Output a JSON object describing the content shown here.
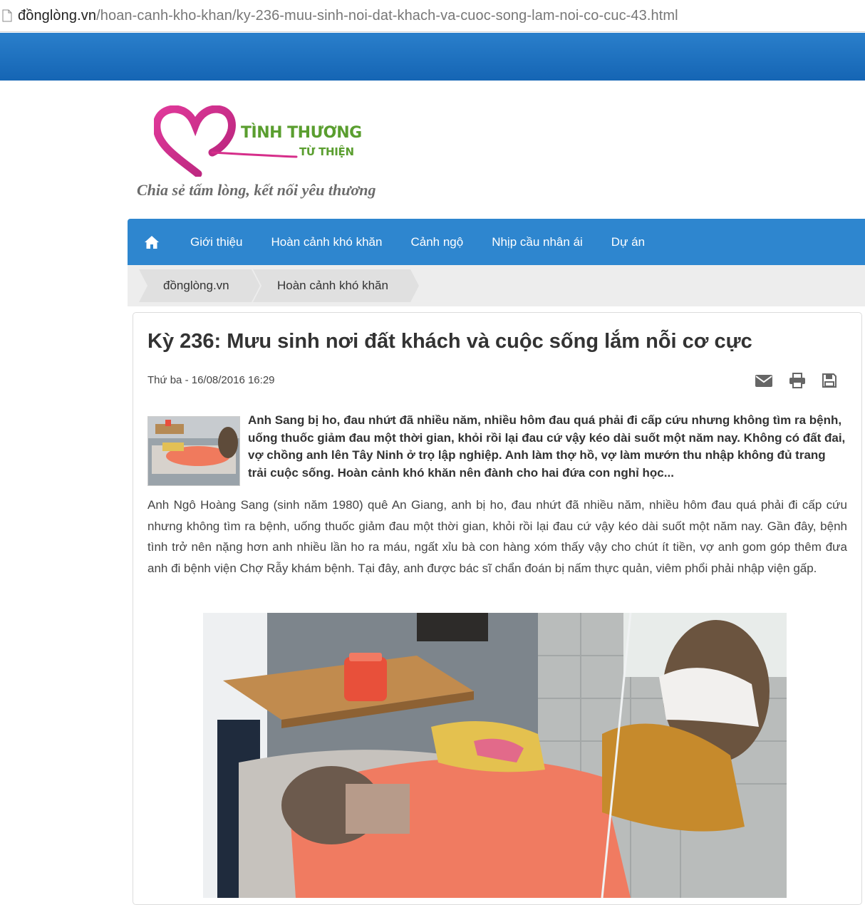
{
  "browser": {
    "url_domain": "đồnglòng.vn",
    "url_path": "/hoan-canh-kho-khan/ky-236-muu-sinh-noi-dat-khach-va-cuoc-song-lam-noi-co-cuc-43.html"
  },
  "header": {
    "logo_line1": "TÌNH THƯƠNG",
    "logo_line2": "TỪ THIỆN",
    "tagline": "Chia sẻ tấm lòng, kết nối yêu thương"
  },
  "nav": {
    "home_icon": "home-icon",
    "items": [
      {
        "label": "Giới thiệu"
      },
      {
        "label": "Hoàn cảnh khó khăn"
      },
      {
        "label": "Cảnh ngộ"
      },
      {
        "label": "Nhịp cầu nhân ái"
      },
      {
        "label": "Dự án"
      }
    ]
  },
  "breadcrumb": {
    "items": [
      {
        "label": "đồnglòng.vn"
      },
      {
        "label": "Hoàn cảnh khó khăn"
      }
    ]
  },
  "article": {
    "title": "Kỳ 236: Mưu sinh nơi đất khách và cuộc sống lắm nỗi cơ cực",
    "date": "Thứ ba - 16/08/2016 16:29",
    "tools": [
      "email-icon",
      "print-icon",
      "save-icon"
    ],
    "summary": "Anh Sang bị ho, đau nhứt đã nhiều năm, nhiều hôm đau quá phải đi cấp cứu nhưng không tìm ra bệnh, uống thuốc giảm đau một thời gian, khỏi rồi lại đau cứ vậy kéo dài suốt một năm nay. Không có đất đai, vợ chồng anh lên Tây Ninh ở trọ lập nghiệp. Anh làm thợ hồ, vợ làm mướn thu nhập không đủ trang trải cuộc sống. Hoàn cảnh khó khăn nên đành cho hai đứa con nghỉ học...",
    "body": "Anh Ngô Hoàng Sang (sinh năm 1980) quê An Giang, anh bị ho, đau nhứt đã nhiều năm, nhiều hôm đau quá phải đi cấp cứu nhưng không tìm ra bệnh, uống thuốc giảm đau một thời gian, khỏi rồi lại đau cứ vậy kéo dài suốt một năm nay. Gần đây, bệnh tình trở nên nặng hơn anh nhiều lần ho ra máu, ngất xỉu bà con hàng xóm thấy vậy cho chút ít tiền, vợ anh gom góp thêm đưa anh đi bệnh viện Chợ Rẫy khám bệnh. Tại đây, anh được bác sĩ chẩn đoán bị nấm thực quản, viêm phổi phải nhập viện gấp."
  },
  "colors": {
    "top_band": "#1d6fbf",
    "nav_bg": "#2e86cf",
    "logo_pink": "#d62e8a",
    "logo_green": "#5a9e2f"
  }
}
